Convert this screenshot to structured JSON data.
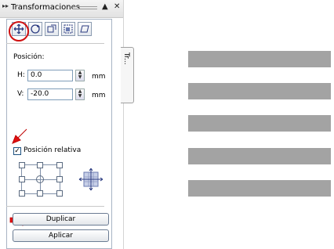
{
  "panel": {
    "title": "Transformaciones",
    "collapse_glyph": "▸▸",
    "pin_glyph": "▲",
    "close_glyph": "✕",
    "side_tab_label": "Tr..."
  },
  "toolbar": {
    "icons": [
      "position-icon",
      "rotate-icon",
      "scale-icon",
      "size-icon",
      "skew-icon"
    ]
  },
  "position": {
    "section_label": "Posición:",
    "h_label": "H:",
    "h_value": "0.0",
    "v_label": "V:",
    "v_value": "-20.0",
    "unit": "mm"
  },
  "relative": {
    "label": "Posición relativa",
    "checked": true,
    "check_glyph": "✓"
  },
  "buttons": {
    "duplicate": "Duplicar",
    "apply": "Aplicar"
  },
  "colors": {
    "highlight": "#d01010",
    "stripe": "#a3a3a3"
  },
  "canvas": {
    "stripe_count": 5
  }
}
